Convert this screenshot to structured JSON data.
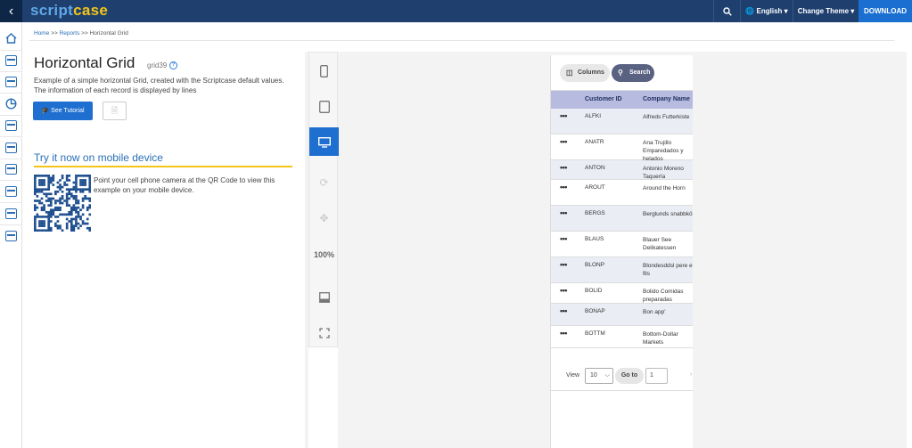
{
  "topbar": {
    "logo_a": "script",
    "logo_b": "case",
    "language": "English",
    "theme": "Change Theme",
    "download": "DOWNLOAD"
  },
  "breadcrumb": [
    "Home",
    ">>",
    "Reports",
    ">>",
    "Horizontal Grid"
  ],
  "page": {
    "title": "Horizontal Grid",
    "subtitle": "grid39",
    "description": "Example of a simple horizontal Grid, created with the Scriptcase default values. The information of each record is displayed by lines",
    "tutorial_button": "See Tutorial",
    "mobile_title": "Try it now on mobile device",
    "qr_text": "Point your cell phone camera at the QR Code to view this example on your mobile device."
  },
  "device_bar": {
    "zoom": "100%"
  },
  "grid": {
    "toolbar": {
      "columns": "Columns",
      "search": "Search"
    },
    "headers": {
      "id": "Customer ID",
      "name": "Company Name"
    },
    "rows": [
      {
        "id": "ALFKI",
        "name": "Alfreds Futterkiste"
      },
      {
        "id": "ANATR",
        "name": "Ana Trujillo Emparedados y helados"
      },
      {
        "id": "ANTON",
        "name": "Antonio Moreno Taquería"
      },
      {
        "id": "AROUT",
        "name": "Around the Horn"
      },
      {
        "id": "BERGS",
        "name": "Berglunds snabbköp"
      },
      {
        "id": "BLAUS",
        "name": "Blauer See Delikatessen"
      },
      {
        "id": "BLONP",
        "name": "Blondesddsl pere et fils"
      },
      {
        "id": "BOLID",
        "name": "Bolido Comidas preparadas"
      },
      {
        "id": "BONAP",
        "name": "Bon app'"
      },
      {
        "id": "BOTTM",
        "name": "Bottom-Dollar Markets"
      }
    ],
    "pager": {
      "view": "View",
      "per_page": "10",
      "goto": "Go to",
      "page": "1"
    }
  }
}
